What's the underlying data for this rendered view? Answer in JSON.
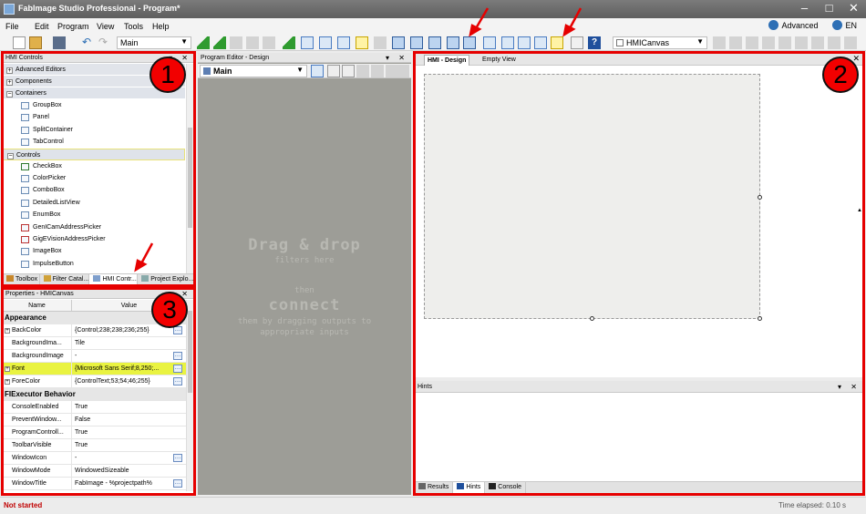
{
  "window": {
    "title": "FabImage Studio Professional - Program*",
    "controls": [
      "–",
      "□",
      "✕"
    ]
  },
  "menu": {
    "items": [
      "File",
      "Edit",
      "Program",
      "View",
      "Tools",
      "Help"
    ],
    "advanced": "Advanced",
    "language": "EN"
  },
  "toolbar": {
    "program_combo": "Main",
    "hmi_combo": "HMICanvas",
    "icons": [
      "new-file-icon",
      "open-folder-icon",
      "save-icon",
      "undo-icon",
      "redo-icon",
      "run-icon",
      "iterate-icon",
      "pause-icon",
      "stop-icon",
      "step-back-icon",
      "step-icon",
      "step-over-icon",
      "step-out-icon",
      "step-in-icon",
      "wand-icon",
      "layout-icon",
      "help-icon",
      "mail-icon"
    ]
  },
  "hmi_controls": {
    "header": "HMI Controls",
    "categories": [
      {
        "label": "Advanced Editors",
        "state": "+"
      },
      {
        "label": "Components",
        "state": "+"
      },
      {
        "label": "Containers",
        "state": "−",
        "items": [
          "GroupBox",
          "Panel",
          "SplitContainer",
          "TabControl"
        ]
      },
      {
        "label": "Controls",
        "state": "−",
        "items": [
          "CheckBox",
          "ColorPicker",
          "ComboBox",
          "DetailedListView",
          "EnumBox",
          "GenICamAddressPicker",
          "GigEVisionAddressPicker",
          "ImageBox",
          "ImpulseButton"
        ]
      }
    ],
    "tabs": [
      "Toolbox",
      "Filter Catal...",
      "HMI Contr...",
      "Project Explo..."
    ]
  },
  "properties": {
    "header": "Properties - HMICanvas",
    "col_name": "Name",
    "col_value": "Value",
    "groups": [
      {
        "label": "Appearance",
        "rows": [
          {
            "name": "BackColor",
            "value": "{Control;238;238;236;255}",
            "expand": true,
            "ellipsis": true
          },
          {
            "name": "BackgroundIma...",
            "value": "Tile"
          },
          {
            "name": "BackgroundImage",
            "value": "-",
            "ellipsis": true
          },
          {
            "name": "Font",
            "value": "{Microsoft Sans Serif;8,250;...",
            "expand": true,
            "ellipsis": true,
            "highlight": true
          },
          {
            "name": "ForeColor",
            "value": "{ControlText;53;54;46;255}",
            "expand": true,
            "ellipsis": true
          }
        ]
      },
      {
        "label": "FIExecutor Behavior",
        "rows": [
          {
            "name": "ConsoleEnabled",
            "value": "True"
          },
          {
            "name": "PreventWindow...",
            "value": "False"
          },
          {
            "name": "ProgramControll...",
            "value": "True"
          },
          {
            "name": "ToolbarVisible",
            "value": "True"
          },
          {
            "name": "WindowIcon",
            "value": "-",
            "ellipsis": true
          },
          {
            "name": "WindowMode",
            "value": "WindowedSizeable"
          },
          {
            "name": "WindowTitle",
            "value": "FabImage - %projectpath%",
            "ellipsis": true
          }
        ]
      }
    ]
  },
  "program_editor": {
    "header": "Program Editor - Design",
    "combo": "Main",
    "drag_title": "Drag & drop",
    "drag_sub": "filters here",
    "then": "then",
    "connect_title": "connect",
    "connect_sub1": "them by dragging outputs to",
    "connect_sub2": "appropriate inputs"
  },
  "hmi_design": {
    "tab_active": "HMI - Design",
    "tab_other": "Empty View"
  },
  "hints": {
    "header": "Hints",
    "tabs": [
      "Results",
      "Hints",
      "Console"
    ]
  },
  "status": {
    "left": "Not started",
    "right": "Time elapsed: 0.10 s"
  },
  "annotations": {
    "badges": [
      "1",
      "2",
      "3"
    ]
  },
  "colors": {
    "annotation_red": "#e60000",
    "highlight_yellow": "#e9f341",
    "editor_grey": "#9d9d97"
  }
}
